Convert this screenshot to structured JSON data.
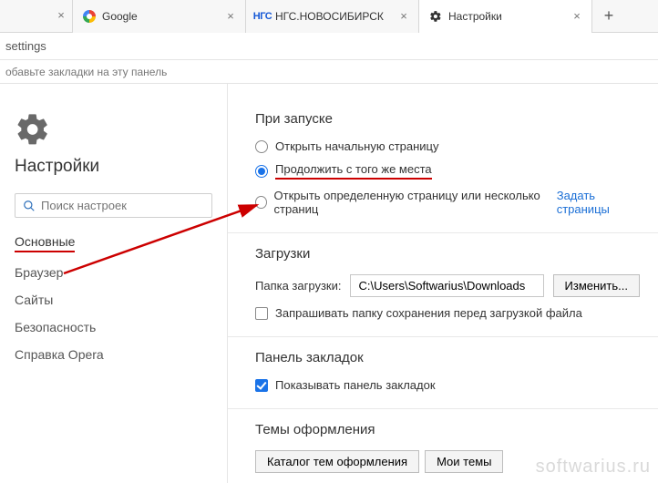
{
  "tabs": {
    "google": "Google",
    "ngs": "НГС.НОВОСИБИРСК",
    "ngs_icon": "НГС",
    "settings": "Настройки"
  },
  "address": "settings",
  "bookbar_hint": "обавьте закладки на эту панель",
  "sidebar": {
    "title": "Настройки",
    "search_placeholder": "Поиск настроек",
    "items": [
      "Основные",
      "Браузер",
      "Сайты",
      "Безопасность",
      "Справка Opera"
    ]
  },
  "startup": {
    "title": "При запуске",
    "opt1": "Открыть начальную страницу",
    "opt2": "Продолжить с того же места",
    "opt3": "Открыть определенную страницу или несколько страниц",
    "opt3_link": "Задать страницы"
  },
  "downloads": {
    "title": "Загрузки",
    "label": "Папка загрузки:",
    "path": "C:\\Users\\Softwarius\\Downloads",
    "change": "Изменить...",
    "ask": "Запрашивать папку сохранения перед загрузкой файла"
  },
  "bookmarks_panel": {
    "title": "Панель закладок",
    "show": "Показывать панель закладок"
  },
  "themes": {
    "title": "Темы оформления",
    "catalog": "Каталог тем оформления",
    "mine": "Мои темы"
  },
  "watermark": "softwarius.ru"
}
